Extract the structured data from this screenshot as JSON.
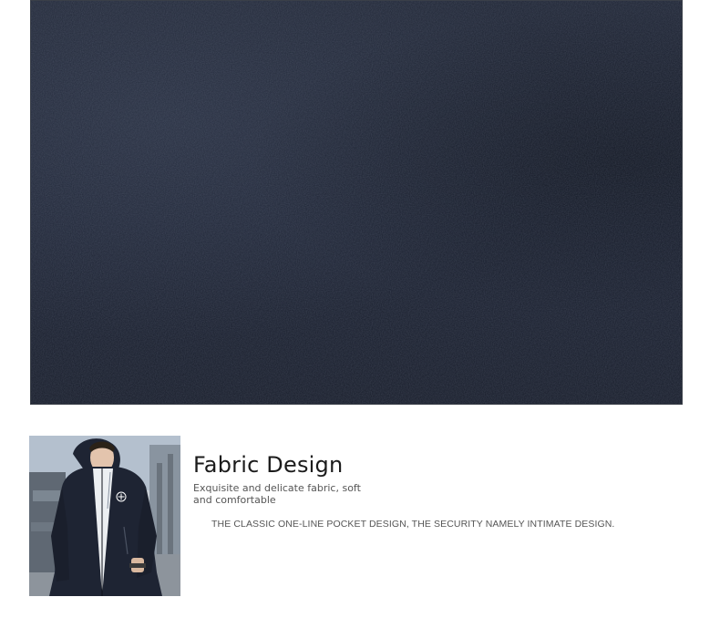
{
  "fabric_section": {
    "title": "Fabric Design",
    "subtitle": "Exquisite and delicate fabric, soft and comfortable",
    "description": "THE CLASSIC ONE-LINE POCKET DESIGN, THE SECURITY NAMELY INTIMATE DESIGN."
  },
  "colors": {
    "fabric": "#1b2130",
    "jacket": "#1e2433",
    "text_dark": "#1b1b1b",
    "text_muted": "#555555"
  }
}
